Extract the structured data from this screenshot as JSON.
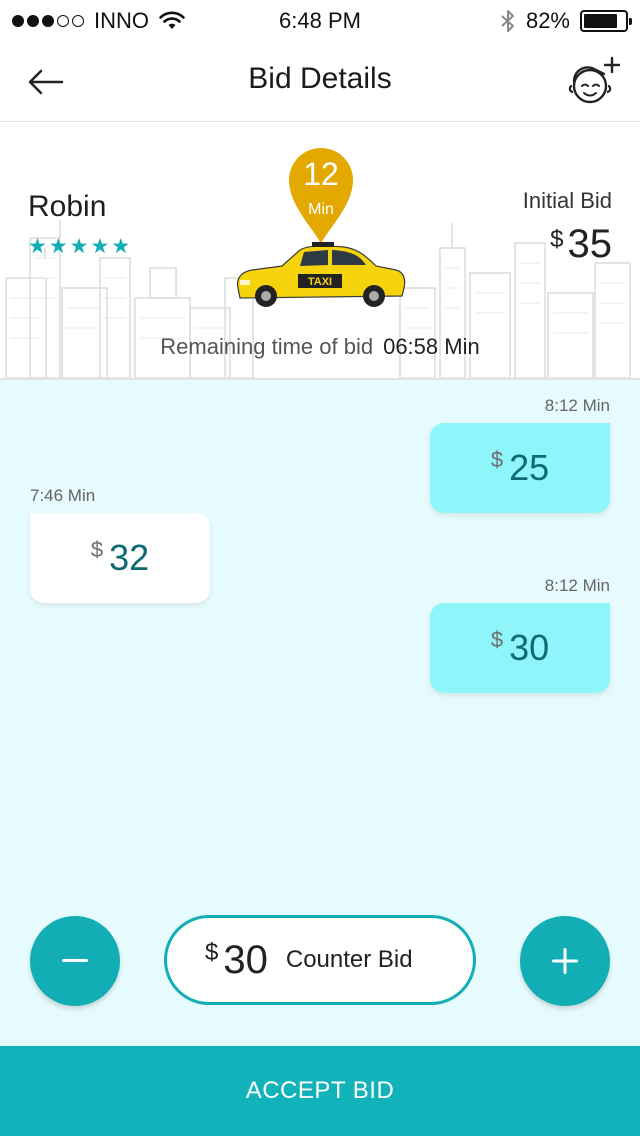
{
  "status_bar": {
    "carrier": "INNO",
    "time": "6:48 PM",
    "battery": "82%",
    "battery_level": 0.82
  },
  "header": {
    "title": "Bid Details",
    "back_icon": "arrow-left-icon",
    "profile_icon": "add-face-icon"
  },
  "hero": {
    "driver_name": "Robin",
    "rating_stars": 5,
    "eta_value": "12",
    "eta_unit": "Min",
    "taxi_label": "TAXI",
    "initial_bid_label": "Initial Bid",
    "initial_bid_currency": "$",
    "initial_bid_amount": "35",
    "remaining_label": "Remaining time of bid",
    "remaining_time": "06:58 Min"
  },
  "bids": [
    {
      "from": "mine",
      "time": "8:12 Min",
      "currency": "$",
      "amount": "25"
    },
    {
      "from": "theirs",
      "time": "7:46 Min",
      "currency": "$",
      "amount": "32"
    },
    {
      "from": "mine",
      "time": "8:12 Min",
      "currency": "$",
      "amount": "30"
    }
  ],
  "counter": {
    "currency": "$",
    "amount": "30",
    "label": "Counter Bid",
    "minus_icon": "minus-icon",
    "plus_icon": "plus-icon"
  },
  "accept_button": {
    "label": "ACCEPT BID"
  },
  "colors": {
    "accent": "#13aeb5",
    "my_bid_bg": "#8ef5fb",
    "content_bg": "#e6fbfd",
    "pin": "#e4a900",
    "taxi": "#f6d40c"
  }
}
